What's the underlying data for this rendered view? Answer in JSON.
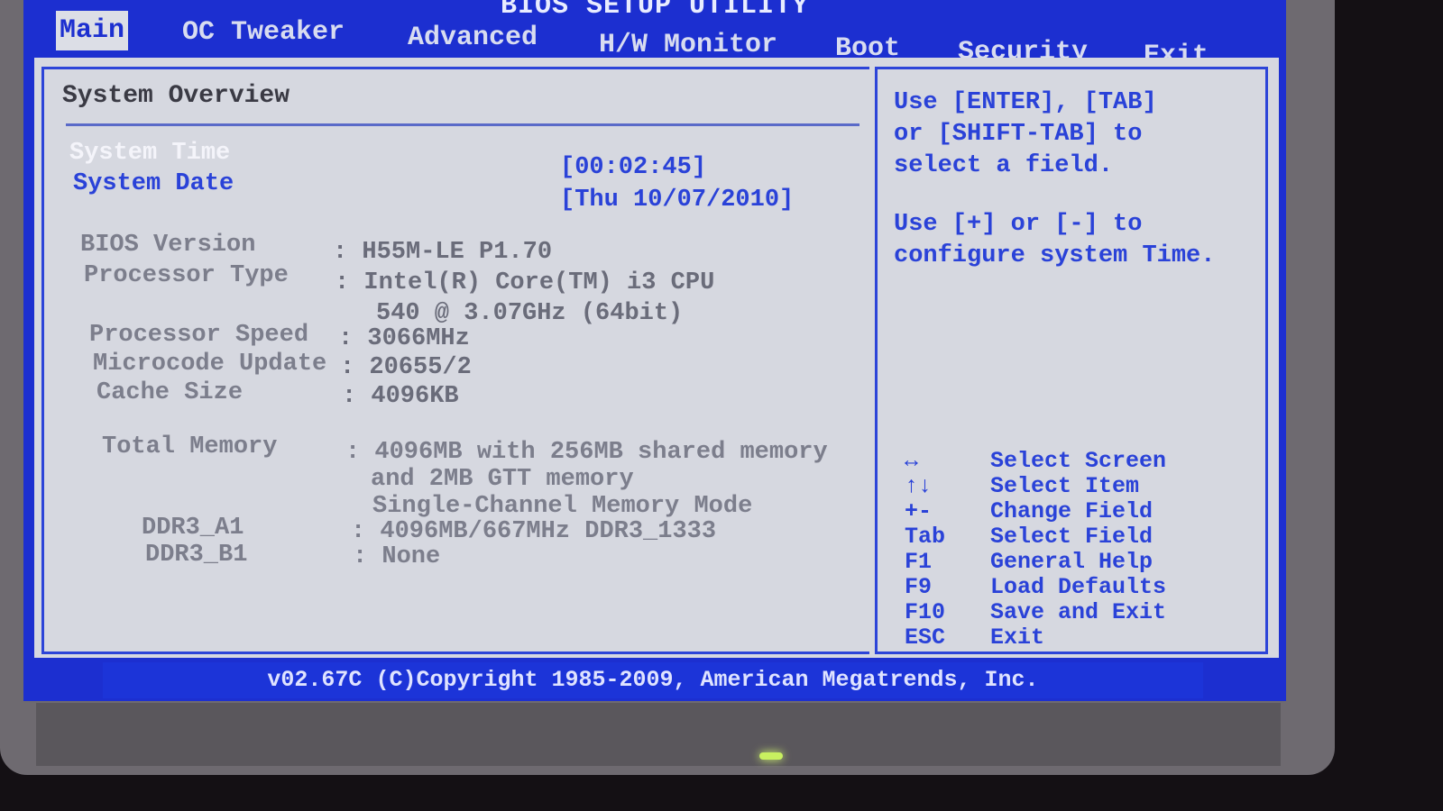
{
  "title": "BIOS SETUP UTILITY",
  "tabs": [
    "Main",
    "OC Tweaker",
    "Advanced",
    "H/W Monitor",
    "Boot",
    "Security",
    "Exit"
  ],
  "active_tab": "Main",
  "section_title": "System Overview",
  "system_time": {
    "label": "System Time",
    "value": "[00:02:45]"
  },
  "system_date": {
    "label": "System Date",
    "value": "[Thu 10/07/2010]"
  },
  "info": [
    {
      "label": "BIOS Version",
      "value": ": H55M-LE P1.70"
    },
    {
      "label": "Processor Type",
      "value": ": Intel(R) Core(TM) i3 CPU",
      "value2": "540  @ 3.07GHz (64bit)"
    },
    {
      "label": "Processor Speed",
      "value": ": 3066MHz"
    },
    {
      "label": "Microcode Update",
      "value": ": 20655/2"
    },
    {
      "label": "Cache Size",
      "value": ": 4096KB"
    }
  ],
  "memory": {
    "label": "Total Memory",
    "value": ": 4096MB with 256MB shared memory",
    "value2": "and 2MB GTT memory",
    "value3": "Single-Channel Memory Mode",
    "slots": [
      {
        "label": "DDR3_A1",
        "value": ": 4096MB/667MHz DDR3_1333"
      },
      {
        "label": "DDR3_B1",
        "value": ": None"
      }
    ]
  },
  "help": {
    "line1": "Use [ENTER], [TAB]",
    "line2": "or [SHIFT-TAB] to",
    "line3": "select a field.",
    "line4": "Use [+] or [-] to",
    "line5": "configure system Time."
  },
  "keys": [
    {
      "key": "↔",
      "desc": "Select Screen"
    },
    {
      "key": "↑↓",
      "desc": "Select Item"
    },
    {
      "key": "+-",
      "desc": "Change Field"
    },
    {
      "key": "Tab",
      "desc": "Select Field"
    },
    {
      "key": "F1",
      "desc": "General Help"
    },
    {
      "key": "F9",
      "desc": "Load Defaults"
    },
    {
      "key": "F10",
      "desc": "Save and Exit"
    },
    {
      "key": "ESC",
      "desc": "Exit"
    }
  ],
  "footer": "v02.67C (C)Copyright 1985-2009, American Megatrends, Inc.",
  "colors": {
    "bios_blue": "#1c2fd0",
    "panel": "#d6d8e0",
    "text_blue": "#2a42d8"
  }
}
